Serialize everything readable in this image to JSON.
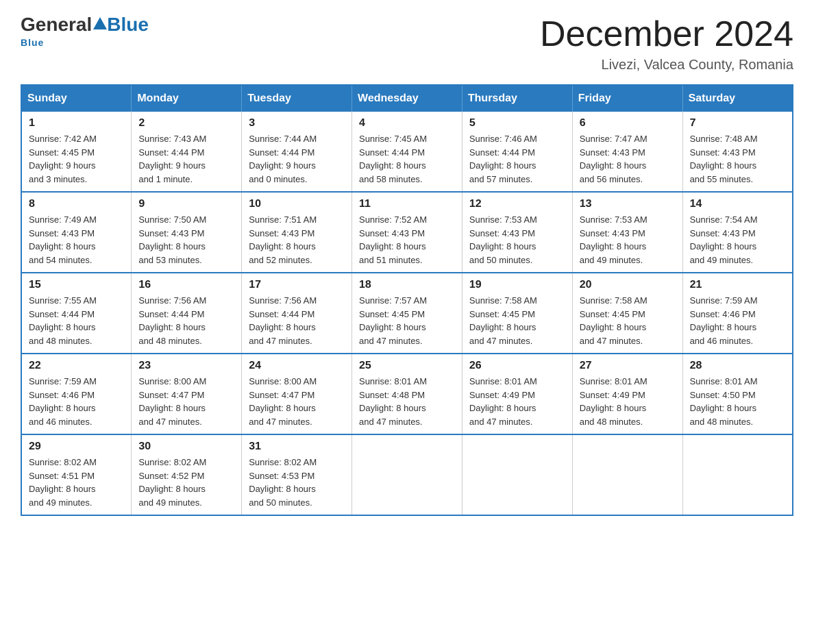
{
  "logo": {
    "general": "General",
    "blue": "Blue",
    "underline": "Blue"
  },
  "header": {
    "title": "December 2024",
    "subtitle": "Livezi, Valcea County, Romania"
  },
  "weekdays": [
    "Sunday",
    "Monday",
    "Tuesday",
    "Wednesday",
    "Thursday",
    "Friday",
    "Saturday"
  ],
  "weeks": [
    [
      {
        "day": "1",
        "sunrise": "7:42 AM",
        "sunset": "4:45 PM",
        "daylight": "9 hours and 3 minutes."
      },
      {
        "day": "2",
        "sunrise": "7:43 AM",
        "sunset": "4:44 PM",
        "daylight": "9 hours and 1 minute."
      },
      {
        "day": "3",
        "sunrise": "7:44 AM",
        "sunset": "4:44 PM",
        "daylight": "9 hours and 0 minutes."
      },
      {
        "day": "4",
        "sunrise": "7:45 AM",
        "sunset": "4:44 PM",
        "daylight": "8 hours and 58 minutes."
      },
      {
        "day": "5",
        "sunrise": "7:46 AM",
        "sunset": "4:44 PM",
        "daylight": "8 hours and 57 minutes."
      },
      {
        "day": "6",
        "sunrise": "7:47 AM",
        "sunset": "4:43 PM",
        "daylight": "8 hours and 56 minutes."
      },
      {
        "day": "7",
        "sunrise": "7:48 AM",
        "sunset": "4:43 PM",
        "daylight": "8 hours and 55 minutes."
      }
    ],
    [
      {
        "day": "8",
        "sunrise": "7:49 AM",
        "sunset": "4:43 PM",
        "daylight": "8 hours and 54 minutes."
      },
      {
        "day": "9",
        "sunrise": "7:50 AM",
        "sunset": "4:43 PM",
        "daylight": "8 hours and 53 minutes."
      },
      {
        "day": "10",
        "sunrise": "7:51 AM",
        "sunset": "4:43 PM",
        "daylight": "8 hours and 52 minutes."
      },
      {
        "day": "11",
        "sunrise": "7:52 AM",
        "sunset": "4:43 PM",
        "daylight": "8 hours and 51 minutes."
      },
      {
        "day": "12",
        "sunrise": "7:53 AM",
        "sunset": "4:43 PM",
        "daylight": "8 hours and 50 minutes."
      },
      {
        "day": "13",
        "sunrise": "7:53 AM",
        "sunset": "4:43 PM",
        "daylight": "8 hours and 49 minutes."
      },
      {
        "day": "14",
        "sunrise": "7:54 AM",
        "sunset": "4:43 PM",
        "daylight": "8 hours and 49 minutes."
      }
    ],
    [
      {
        "day": "15",
        "sunrise": "7:55 AM",
        "sunset": "4:44 PM",
        "daylight": "8 hours and 48 minutes."
      },
      {
        "day": "16",
        "sunrise": "7:56 AM",
        "sunset": "4:44 PM",
        "daylight": "8 hours and 48 minutes."
      },
      {
        "day": "17",
        "sunrise": "7:56 AM",
        "sunset": "4:44 PM",
        "daylight": "8 hours and 47 minutes."
      },
      {
        "day": "18",
        "sunrise": "7:57 AM",
        "sunset": "4:45 PM",
        "daylight": "8 hours and 47 minutes."
      },
      {
        "day": "19",
        "sunrise": "7:58 AM",
        "sunset": "4:45 PM",
        "daylight": "8 hours and 47 minutes."
      },
      {
        "day": "20",
        "sunrise": "7:58 AM",
        "sunset": "4:45 PM",
        "daylight": "8 hours and 47 minutes."
      },
      {
        "day": "21",
        "sunrise": "7:59 AM",
        "sunset": "4:46 PM",
        "daylight": "8 hours and 46 minutes."
      }
    ],
    [
      {
        "day": "22",
        "sunrise": "7:59 AM",
        "sunset": "4:46 PM",
        "daylight": "8 hours and 46 minutes."
      },
      {
        "day": "23",
        "sunrise": "8:00 AM",
        "sunset": "4:47 PM",
        "daylight": "8 hours and 47 minutes."
      },
      {
        "day": "24",
        "sunrise": "8:00 AM",
        "sunset": "4:47 PM",
        "daylight": "8 hours and 47 minutes."
      },
      {
        "day": "25",
        "sunrise": "8:01 AM",
        "sunset": "4:48 PM",
        "daylight": "8 hours and 47 minutes."
      },
      {
        "day": "26",
        "sunrise": "8:01 AM",
        "sunset": "4:49 PM",
        "daylight": "8 hours and 47 minutes."
      },
      {
        "day": "27",
        "sunrise": "8:01 AM",
        "sunset": "4:49 PM",
        "daylight": "8 hours and 48 minutes."
      },
      {
        "day": "28",
        "sunrise": "8:01 AM",
        "sunset": "4:50 PM",
        "daylight": "8 hours and 48 minutes."
      }
    ],
    [
      {
        "day": "29",
        "sunrise": "8:02 AM",
        "sunset": "4:51 PM",
        "daylight": "8 hours and 49 minutes."
      },
      {
        "day": "30",
        "sunrise": "8:02 AM",
        "sunset": "4:52 PM",
        "daylight": "8 hours and 49 minutes."
      },
      {
        "day": "31",
        "sunrise": "8:02 AM",
        "sunset": "4:53 PM",
        "daylight": "8 hours and 50 minutes."
      },
      null,
      null,
      null,
      null
    ]
  ],
  "labels": {
    "sunrise": "Sunrise:",
    "sunset": "Sunset:",
    "daylight": "Daylight:"
  }
}
